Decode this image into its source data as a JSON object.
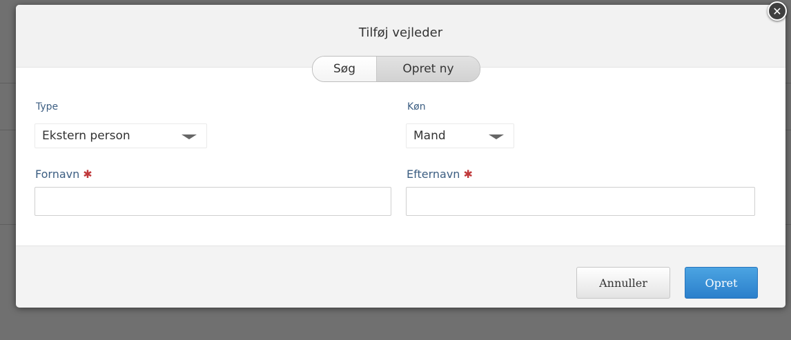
{
  "dialog": {
    "title": "Tilføj vejleder",
    "close_icon": "close-icon",
    "tabs": [
      {
        "label": "Søg",
        "active": false
      },
      {
        "label": "Opret ny",
        "active": true
      }
    ]
  },
  "form": {
    "type": {
      "label": "Type",
      "value": "Ekstern person"
    },
    "gender": {
      "label": "Køn",
      "value": "Mand"
    },
    "first_name": {
      "label": "Fornavn",
      "required_mark": "✱",
      "value": ""
    },
    "last_name": {
      "label": "Efternavn",
      "required_mark": "✱",
      "value": ""
    }
  },
  "footer": {
    "cancel_label": "Annuller",
    "create_label": "Opret"
  },
  "colors": {
    "primary": "#2b7fcb",
    "required": "#c0393b",
    "label": "#3c5e82"
  }
}
